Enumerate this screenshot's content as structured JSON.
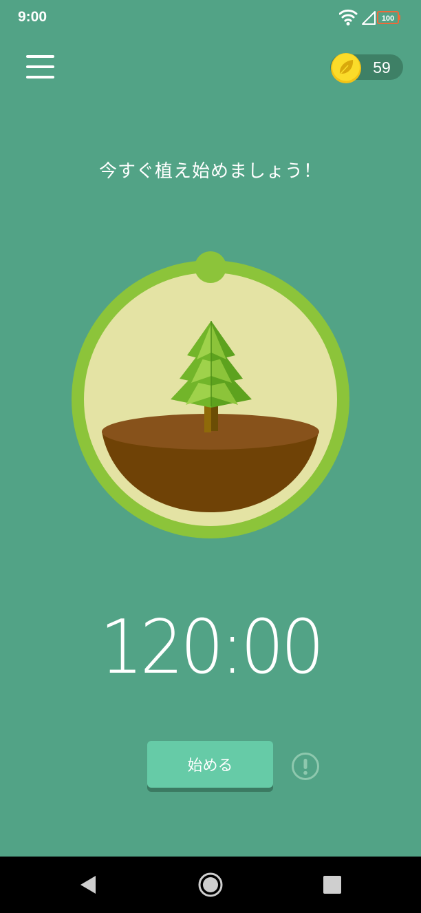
{
  "status_bar": {
    "time": "9:00",
    "battery_level": "100",
    "icons": [
      "wifi-icon",
      "cellular-signal-icon",
      "battery-icon"
    ]
  },
  "header": {
    "menu_icon": "hamburger-menu-icon",
    "coin_icon": "gold-coin-leaf-icon",
    "coin_count": "59"
  },
  "main": {
    "headline": "今すぐ植え始めましょう！",
    "illustration": "pine-tree-in-soil-bowl",
    "timer": "120:00",
    "start_button_label": "始める",
    "info_icon": "exclamation-circle-icon"
  },
  "nav_bar": {
    "buttons": [
      "back-triangle-icon",
      "home-circle-icon",
      "recents-square-icon"
    ]
  },
  "colors": {
    "background": "#52a386",
    "ring": "#8cc43a",
    "dial_fill": "#e4e3a4",
    "soil_top": "#87521b",
    "soil_bowl": "#6f4206",
    "button": "#66cba7",
    "coin": "#f7d21f"
  }
}
